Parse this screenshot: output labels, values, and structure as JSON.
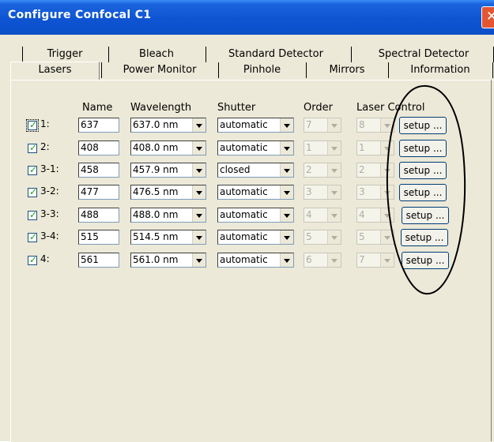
{
  "window": {
    "title": "Configure Confocal C1",
    "close_glyph": "✕"
  },
  "tabs": {
    "row1": [
      "Trigger",
      "Bleach",
      "Standard Detector",
      "Spectral Detector"
    ],
    "row2": [
      "Lasers",
      "Power Monitor",
      "Pinhole",
      "Mirrors",
      "Information"
    ],
    "active": "Lasers"
  },
  "columns": {
    "name": "Name",
    "wavelength": "Wavelength",
    "shutter": "Shutter",
    "order": "Order",
    "laser_control": "Laser Control"
  },
  "lasers": [
    {
      "label": "1:",
      "checked": true,
      "name": "637",
      "wavelength": "637.0 nm",
      "shutter": "automatic",
      "order": "7",
      "control": "8",
      "setup_label": "setup ..."
    },
    {
      "label": "2:",
      "checked": true,
      "name": "408",
      "wavelength": "408.0 nm",
      "shutter": "automatic",
      "order": "1",
      "control": "1",
      "setup_label": "setup ..."
    },
    {
      "label": "3-1:",
      "checked": true,
      "name": "458",
      "wavelength": "457.9 nm",
      "shutter": "closed",
      "order": "2",
      "control": "2",
      "setup_label": "setup ..."
    },
    {
      "label": "3-2:",
      "checked": true,
      "name": "477",
      "wavelength": "476.5 nm",
      "shutter": "automatic",
      "order": "3",
      "control": "3",
      "setup_label": "setup ..."
    },
    {
      "label": "3-3:",
      "checked": true,
      "name": "488",
      "wavelength": "488.0 nm",
      "shutter": "automatic",
      "order": "4",
      "control": "4",
      "setup_label": "setup ..."
    },
    {
      "label": "3-4:",
      "checked": true,
      "name": "515",
      "wavelength": "514.5 nm",
      "shutter": "automatic",
      "order": "5",
      "control": "5",
      "setup_label": "setup ..."
    },
    {
      "label": "4:",
      "checked": true,
      "name": "561",
      "wavelength": "561.0 nm",
      "shutter": "automatic",
      "order": "6",
      "control": "7",
      "setup_label": "setup ..."
    }
  ],
  "colors": {
    "titlebar": "#0b4ec8",
    "dialog_bg": "#ece9d8",
    "close_button": "#e35631",
    "checkmark": "#21a121",
    "annotation": "#000000"
  }
}
